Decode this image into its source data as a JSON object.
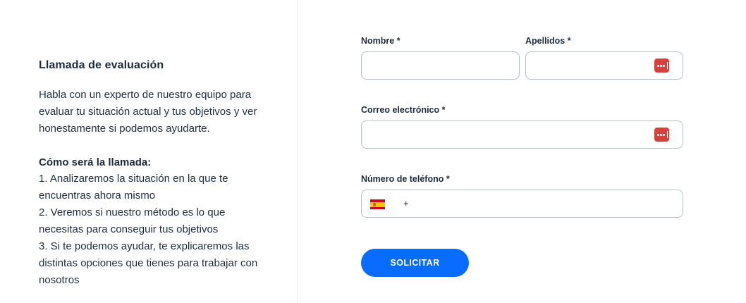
{
  "info": {
    "title": "Llamada de evaluación",
    "description": "Habla con un experto de nuestro equipo para evaluar tu situación actual y tus objetivos y ver honestamente si podemos ayudarte.",
    "how_title": "Cómo será la llamada:",
    "steps": [
      "1. Analizaremos la situación en la que te encuentras ahora mismo",
      "2. Veremos si nuestro método es lo que necesitas para conseguir tus objetivos",
      "3. Si te podemos ayudar, te explicaremos las distintas opciones que tienes para trabajar con nosotros"
    ]
  },
  "form": {
    "first_name": {
      "label": "Nombre *",
      "value": "",
      "placeholder": ""
    },
    "last_name": {
      "label": "Apellidos *",
      "value": "",
      "placeholder": "",
      "icon": "password-manager-icon"
    },
    "email": {
      "label": "Correo electrónico *",
      "value": "",
      "placeholder": "",
      "icon": "password-manager-icon"
    },
    "phone": {
      "label": "Número de teléfono *",
      "country_flag": "spain-flag-icon",
      "prefix": "+",
      "value": ""
    },
    "submit_label": "SOLICITAR"
  },
  "colors": {
    "accent": "#0a6cff",
    "password_manager_icon": "#d8403c",
    "text": "#1d2b3a",
    "border": "#b8c0ca"
  }
}
